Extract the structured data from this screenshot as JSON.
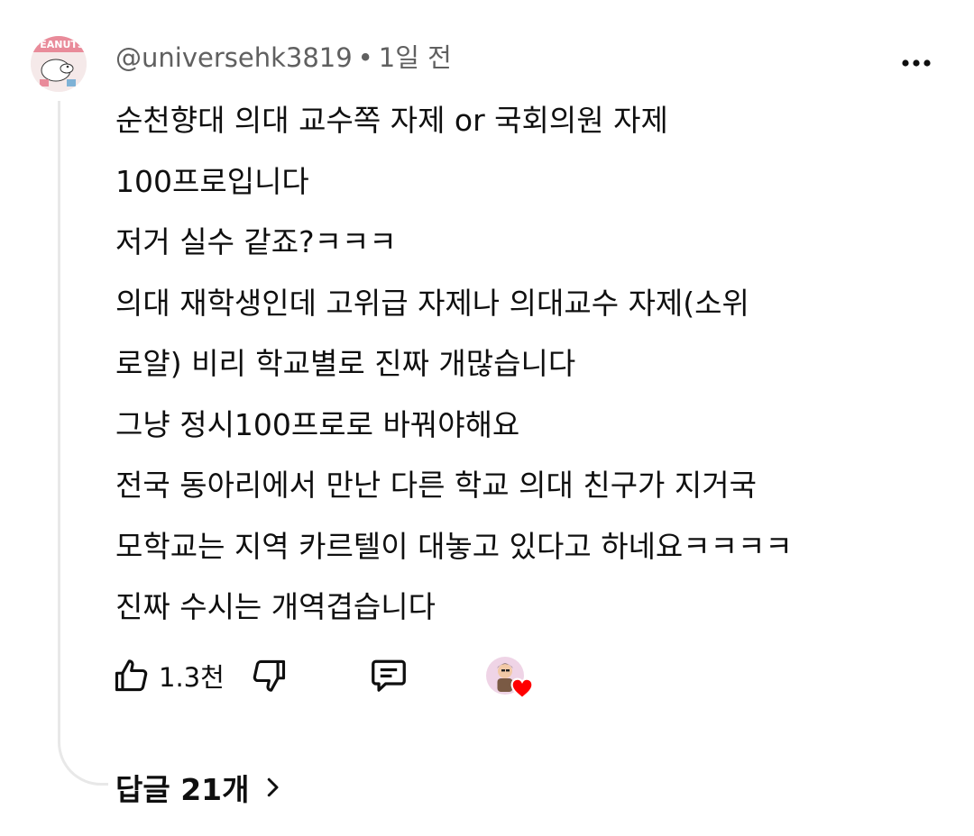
{
  "comment": {
    "author": "@universehk3819",
    "separator": "•",
    "time": "1일 전",
    "avatar_label": "PEANUTS",
    "lines": [
      "순천향대 의대 교수쪽 자제 or 국회의원 자제",
      "100프로입니다",
      "저거 실수 같죠?ㅋㅋㅋ",
      "의대 재학생인데 고위급 자제나 의대교수 자제(소위",
      "로얄) 비리 학교별로 진짜 개많습니다",
      "그냥 정시100프로로 바꿔야해요",
      "전국 동아리에서 만난 다른 학교 의대 친구가 지거국",
      "모학교는 지역 카르텔이 대놓고 있다고 하네요ㅋㅋㅋㅋ",
      "진짜 수시는 개역겹습니다"
    ]
  },
  "actions": {
    "like_count": "1.3천",
    "icons": {
      "like": "thumbs-up-icon",
      "dislike": "thumbs-down-icon",
      "reply": "comment-icon",
      "more": "more-vertical-icon",
      "heart": "heart-icon",
      "chevron": "chevron-right-icon"
    }
  },
  "replies": {
    "label": "답글 21개"
  },
  "colors": {
    "text": "#0f0f0f",
    "meta": "#606060",
    "heart": "#ff0000",
    "thread_line": "#e8e8e8"
  }
}
